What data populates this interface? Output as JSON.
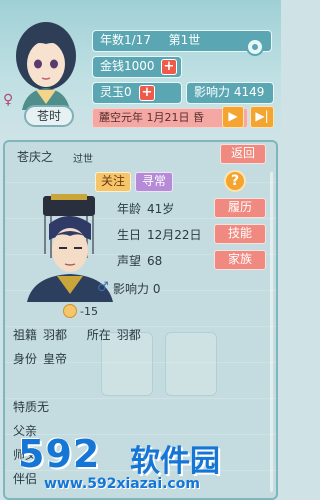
{
  "header": {
    "year_label": "年数1/17",
    "generation_label": "第1世",
    "money_label": "金钱1000",
    "jade_label": "灵玉0",
    "influence_label": "影响力 4149",
    "date_label": "麓空元年 1月21日 昏",
    "player_name": "苍时",
    "plus_symbol": "+",
    "play_symbol": "▶",
    "fast_symbol": "▶|",
    "female_symbol": "♀"
  },
  "panel": {
    "person_name": "苍庆之",
    "status": "过世",
    "back_label": "返回",
    "follow_label": "关注",
    "mode_label": "寻常",
    "help_symbol": "?",
    "stats": [
      {
        "label": "年龄",
        "value": "41岁"
      },
      {
        "label": "生日",
        "value": "12月22日"
      },
      {
        "label": "声望",
        "value": "68"
      }
    ],
    "male_symbol": "♂",
    "influence_label": "影响力",
    "influence_value": "0",
    "mood_value": "-15",
    "side_buttons": [
      "履历",
      "技能",
      "家族"
    ],
    "ancestry_label": "祖籍",
    "ancestry_value": "羽都",
    "residence_label": "所在",
    "residence_value": "羽都",
    "identity_label": "身份",
    "identity_value": "皇帝",
    "trait_label": "特质",
    "trait_value": "无",
    "father_label": "父亲",
    "master_label": "师父",
    "partner_label": "伴侣"
  },
  "watermark": {
    "number": "592",
    "brand": "软件园",
    "url": "www.592xiazai.com"
  },
  "colors": {
    "teal": "#5aa7b3",
    "coral": "#f08a80",
    "orange": "#f4a531",
    "purple": "#b58ad6",
    "watermark_blue": "#1676d6"
  }
}
